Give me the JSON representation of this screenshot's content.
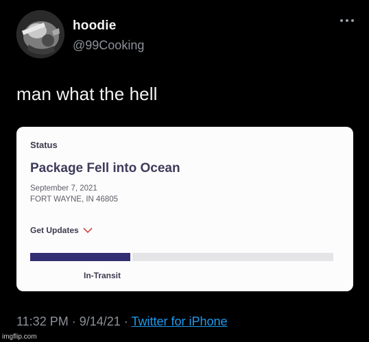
{
  "tweet": {
    "display_name": "hoodie",
    "handle": "@99Cooking",
    "text": "man what the hell",
    "time": "11:32 PM",
    "separator1": " · ",
    "date": "9/14/21",
    "separator2": " · ",
    "source": "Twitter for iPhone",
    "more_icon": "more-horizontal-icon"
  },
  "card": {
    "status_label": "Status",
    "heading": "Package Fell into Ocean",
    "date": "September 7, 2021",
    "location": "FORT WAYNE, IN 46805",
    "get_updates_label": "Get Updates",
    "get_updates_icon": "chevron-down-icon",
    "progress_fraction": 0.33,
    "progress_color": "#322e73",
    "progress_label": "In-Transit"
  },
  "colors": {
    "background": "#000000",
    "link": "#1d9bf0",
    "muted": "#8d9299"
  },
  "watermark": "imgflip.com"
}
